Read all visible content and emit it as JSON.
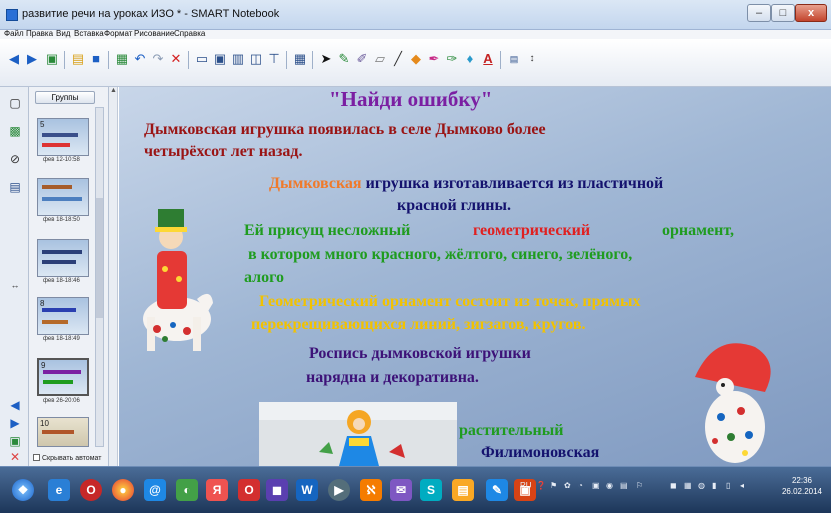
{
  "window": {
    "title": "развитие речи на уроках ИЗО * - SMART Notebook",
    "minimize": "–",
    "maximize": "□",
    "close": "x"
  },
  "menu": [
    "Файл",
    "Правка",
    "Вид",
    "Вставка",
    "Формат",
    "Рисование",
    "Справка"
  ],
  "sorter": {
    "groups_label": "Группы",
    "hide_label": "Скрывать автомат",
    "thumbs": [
      {
        "num": "5",
        "time": "фев 12-10:58"
      },
      {
        "num": "",
        "time": "фев 18-18:50"
      },
      {
        "num": "",
        "time": "фев 18-18:46"
      },
      {
        "num": "8",
        "time": "фев 18-18:49"
      },
      {
        "num": "9",
        "time": "фев 26-20:06"
      },
      {
        "num": "10",
        "time": ""
      }
    ]
  },
  "slide": {
    "title": "\"Найди ошибку\"",
    "line1a": "Дымковская игрушка появилась в селе Дымково более",
    "line1b": "четырёхсот лет назад.",
    "line2_orange": "Дымковская",
    "line2_rest": "игрушка изготавливается из пластичной",
    "line2b": "красной глины.",
    "line3_start": "Ей присущ несложный",
    "line3_red": "геометрический",
    "line3_end": "орнамент,",
    "line3b": "в котором много красного, жёлтого, синего, зелёного,",
    "line3c": "алого",
    "line4a": "Геометрический орнамент состоит из точек, прямых",
    "line4b": "перекрещивающихся линий, зигзагов, кругов.",
    "line5a": "Роспись дымковской игрушки",
    "line5b": "нарядна и декоративна.",
    "word_plant": "растительный",
    "word_filim": "Филимоновская"
  },
  "taskbar": {
    "tray_lang": "RU",
    "time": "22:36",
    "date": "26.02.2014"
  },
  "colors": {
    "title_purple": "#7b1fa2",
    "dark_red": "#9a1414",
    "navy": "#14126e",
    "orange": "#f07a2a",
    "green": "#1f9c1f",
    "red": "#e02020",
    "yellow": "#f2c200"
  }
}
